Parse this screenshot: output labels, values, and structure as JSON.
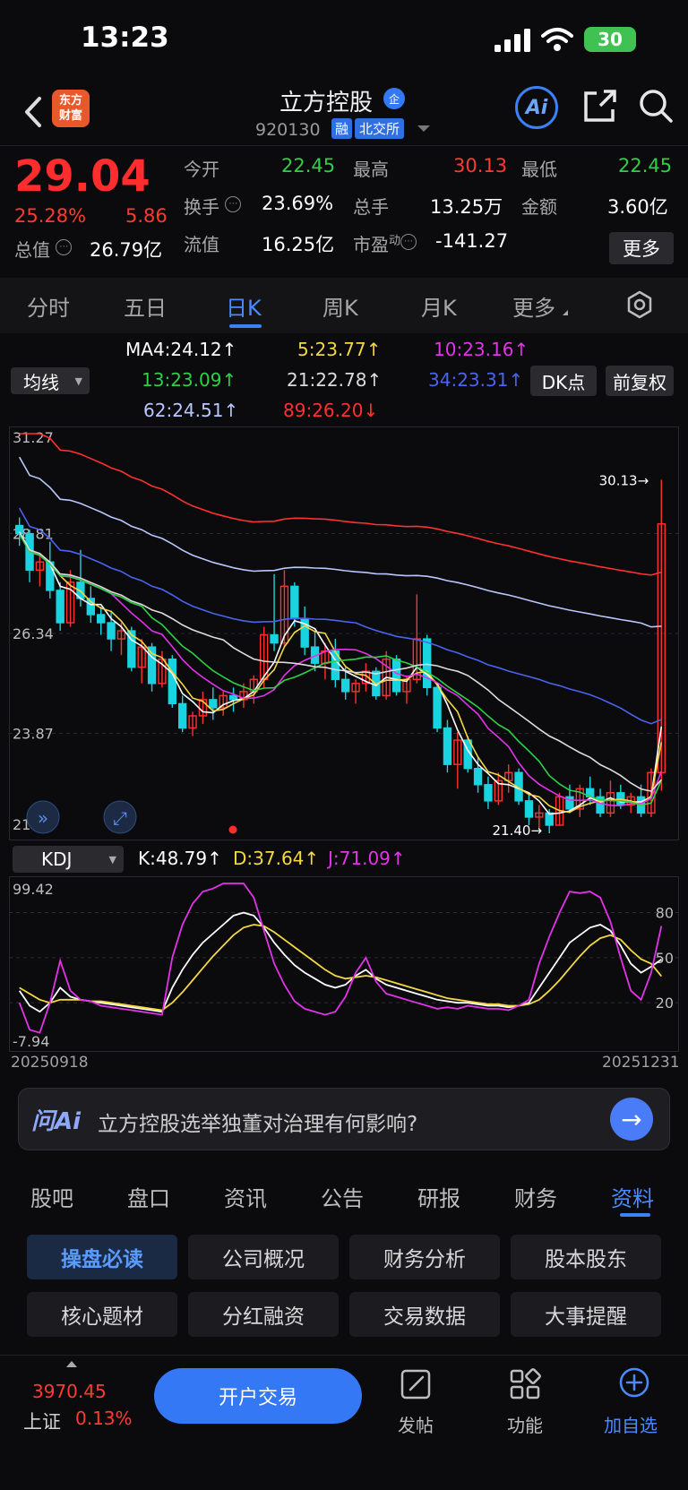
{
  "status": {
    "time": "13:23",
    "battery": "30"
  },
  "header": {
    "logo_line1": "东方",
    "logo_line2": "财富",
    "stock_name": "立方控股",
    "enterprise_badge": "企",
    "stock_code": "920130",
    "tag_margin": "融",
    "tag_exchange": "北交所",
    "ai_label": "Ai"
  },
  "quote": {
    "price": "29.04",
    "change_pct": "25.28%",
    "change_abs": "5.86",
    "open_label": "今开",
    "open": "22.45",
    "high_label": "最高",
    "high": "30.13",
    "low_label": "最低",
    "low": "22.45",
    "turnover_label": "换手",
    "turnover": "23.69%",
    "volume_label": "总手",
    "volume": "13.25万",
    "amount_label": "金额",
    "amount": "3.60亿",
    "mktcap_label": "总值",
    "mktcap": "26.79亿",
    "float_label": "流值",
    "float_cap": "16.25亿",
    "pe_label": "市盈",
    "pe_sup": "动",
    "pe": "-141.27",
    "more_label": "更多"
  },
  "period_tabs": [
    "分时",
    "五日",
    "日K",
    "周K",
    "月K",
    "更多"
  ],
  "ma": {
    "selector": "均线",
    "dk_label": "DK点",
    "adjust_label": "前复权",
    "items": [
      {
        "text": "MA4:24.12↑",
        "color": "#ffffff"
      },
      {
        "text": "5:23.77↑",
        "color": "#f5d742"
      },
      {
        "text": "10:23.16↑",
        "color": "#e233e8"
      },
      {
        "text": "13:23.09↑",
        "color": "#2ed047"
      },
      {
        "text": "21:22.78↑",
        "color": "#dcdcdc"
      },
      {
        "text": "34:23.31↑",
        "color": "#4a63f0"
      },
      {
        "text": "62:24.51↑",
        "color": "#b9c7ff"
      },
      {
        "text": "89:26.20↓",
        "color": "#ff3030"
      }
    ]
  },
  "chart_data": [
    {
      "type": "candlestick",
      "y_ticks": [
        "31.27",
        "28.81",
        "26.34",
        "23.87",
        "21.40"
      ],
      "ylim": [
        21.4,
        31.27
      ],
      "high_marker": "30.13→",
      "low_marker": "21.40→",
      "ohlc": [
        [
          29.0,
          29.2,
          28.5,
          28.8
        ],
        [
          28.8,
          28.9,
          27.6,
          27.9
        ],
        [
          27.9,
          28.3,
          27.5,
          28.1
        ],
        [
          28.1,
          28.6,
          27.2,
          27.4
        ],
        [
          27.4,
          27.6,
          26.4,
          26.6
        ],
        [
          26.6,
          27.9,
          26.5,
          27.6
        ],
        [
          27.6,
          28.4,
          27.0,
          27.2
        ],
        [
          27.2,
          27.5,
          26.6,
          26.8
        ],
        [
          26.8,
          27.0,
          26.3,
          26.6
        ],
        [
          26.6,
          26.9,
          25.9,
          26.2
        ],
        [
          26.2,
          26.6,
          25.8,
          26.4
        ],
        [
          26.4,
          26.5,
          25.4,
          25.5
        ],
        [
          25.5,
          26.2,
          25.1,
          26.0
        ],
        [
          26.0,
          26.1,
          24.9,
          25.1
        ],
        [
          25.1,
          25.9,
          25.0,
          25.7
        ],
        [
          25.7,
          25.8,
          24.5,
          24.6
        ],
        [
          24.6,
          24.8,
          23.9,
          24.0
        ],
        [
          24.0,
          24.4,
          23.8,
          24.3
        ],
        [
          24.3,
          24.9,
          24.1,
          24.7
        ],
        [
          24.7,
          25.0,
          24.2,
          24.5
        ],
        [
          24.5,
          24.9,
          24.3,
          24.8
        ],
        [
          24.8,
          25.0,
          24.4,
          24.7
        ],
        [
          24.7,
          25.1,
          24.5,
          24.9
        ],
        [
          24.9,
          25.3,
          24.6,
          25.2
        ],
        [
          25.2,
          26.5,
          25.0,
          26.3
        ],
        [
          26.3,
          27.8,
          25.9,
          26.1
        ],
        [
          26.1,
          27.9,
          26.0,
          27.5
        ],
        [
          27.5,
          27.6,
          26.5,
          26.7
        ],
        [
          26.7,
          27.0,
          25.8,
          26.0
        ],
        [
          26.0,
          26.4,
          25.4,
          25.6
        ],
        [
          25.6,
          26.1,
          25.2,
          25.9
        ],
        [
          25.9,
          26.2,
          25.0,
          25.2
        ],
        [
          25.2,
          25.5,
          24.7,
          24.9
        ],
        [
          24.9,
          25.2,
          24.6,
          25.1
        ],
        [
          25.1,
          25.6,
          24.9,
          25.4
        ],
        [
          25.4,
          25.5,
          24.7,
          24.8
        ],
        [
          24.8,
          25.9,
          24.7,
          25.7
        ],
        [
          25.7,
          25.8,
          24.8,
          24.9
        ],
        [
          24.9,
          25.3,
          24.6,
          25.2
        ],
        [
          25.2,
          27.3,
          25.1,
          26.2
        ],
        [
          26.2,
          26.3,
          24.8,
          25.0
        ],
        [
          25.0,
          25.1,
          23.9,
          24.0
        ],
        [
          24.0,
          24.2,
          22.9,
          23.1
        ],
        [
          23.1,
          23.9,
          22.5,
          23.7
        ],
        [
          23.7,
          23.8,
          22.9,
          23.0
        ],
        [
          23.0,
          23.3,
          22.4,
          22.6
        ],
        [
          22.6,
          22.8,
          22.0,
          22.2
        ],
        [
          22.2,
          22.9,
          22.1,
          22.7
        ],
        [
          22.7,
          23.1,
          22.4,
          22.9
        ],
        [
          22.9,
          23.0,
          22.1,
          22.2
        ],
        [
          22.2,
          22.4,
          21.6,
          21.8
        ],
        [
          21.8,
          22.1,
          21.5,
          21.9
        ],
        [
          21.9,
          22.0,
          21.4,
          21.6
        ],
        [
          21.6,
          22.4,
          21.6,
          22.3
        ],
        [
          22.3,
          22.6,
          21.9,
          22.0
        ],
        [
          22.0,
          22.6,
          21.8,
          22.5
        ],
        [
          22.5,
          22.8,
          22.1,
          22.3
        ],
        [
          22.3,
          22.5,
          21.8,
          21.9
        ],
        [
          21.9,
          22.7,
          21.8,
          22.4
        ],
        [
          22.4,
          22.6,
          22.0,
          22.1
        ],
        [
          22.1,
          22.4,
          21.9,
          22.3
        ],
        [
          22.3,
          22.6,
          21.8,
          21.9
        ],
        [
          21.9,
          23.0,
          21.8,
          22.9
        ],
        [
          22.9,
          30.13,
          22.45,
          29.04
        ]
      ]
    },
    {
      "type": "line",
      "indicator": "KDJ",
      "y_ticks": [
        "99.42",
        "80",
        "50",
        "20",
        "-7.94"
      ],
      "ylim": [
        -7.94,
        99.42
      ],
      "x_start": "20250918",
      "x_end": "20251231",
      "series": [
        {
          "name": "K:48.79↑",
          "color": "#ffffff",
          "values": [
            28,
            18,
            14,
            20,
            30,
            24,
            22,
            21,
            20,
            19,
            18,
            17,
            16,
            15,
            14,
            30,
            42,
            52,
            60,
            66,
            72,
            78,
            80,
            78,
            70,
            60,
            52,
            45,
            40,
            36,
            32,
            30,
            32,
            38,
            42,
            36,
            32,
            30,
            28,
            26,
            24,
            22,
            21,
            20,
            20,
            19,
            18,
            18,
            17,
            18,
            20,
            30,
            40,
            50,
            60,
            65,
            70,
            72,
            68,
            58,
            46,
            40,
            44,
            48.79
          ]
        },
        {
          "name": "D:37.64↑",
          "color": "#f5d742",
          "values": [
            30,
            26,
            22,
            20,
            22,
            22,
            22,
            21,
            21,
            20,
            19,
            18,
            17,
            16,
            15,
            20,
            27,
            35,
            43,
            51,
            58,
            65,
            70,
            72,
            71,
            67,
            62,
            57,
            52,
            47,
            42,
            38,
            36,
            37,
            38,
            37,
            35,
            33,
            31,
            29,
            27,
            25,
            23,
            22,
            21,
            20,
            19,
            19,
            18,
            18,
            19,
            22,
            28,
            35,
            43,
            51,
            58,
            63,
            65,
            62,
            55,
            49,
            46,
            37.64
          ]
        },
        {
          "name": "J:71.09↑",
          "color": "#e233e8",
          "values": [
            20,
            2,
            0,
            20,
            48,
            28,
            22,
            21,
            18,
            17,
            16,
            15,
            14,
            13,
            12,
            50,
            72,
            86,
            94,
            96,
            100,
            104,
            100,
            90,
            68,
            46,
            32,
            21,
            16,
            14,
            12,
            14,
            24,
            40,
            50,
            34,
            26,
            24,
            22,
            20,
            18,
            16,
            17,
            16,
            18,
            17,
            16,
            16,
            15,
            18,
            22,
            46,
            64,
            80,
            94,
            93,
            94,
            90,
            74,
            50,
            28,
            22,
            40,
            71.09
          ]
        }
      ]
    }
  ],
  "kdj_selector": "KDJ",
  "ai_ask": {
    "logo": "问Ai",
    "question": "立方控股选举独董对治理有何影响?"
  },
  "info_tabs": [
    "股吧",
    "盘口",
    "资讯",
    "公告",
    "研报",
    "财务",
    "资料"
  ],
  "info_grid": [
    "操盘必读",
    "公司概况",
    "财务分析",
    "股本股东",
    "核心题材",
    "分红融资",
    "交易数据",
    "大事提醒"
  ],
  "bottom": {
    "index_value": "3970.45",
    "index_name": "上证",
    "index_pct": "0.13%",
    "trade_label": "开户交易",
    "post_label": "发帖",
    "func_label": "功能",
    "watch_label": "加自选"
  },
  "colors": {
    "up": "#ff3030",
    "down": "#19d3e0",
    "accent": "#3478f6"
  }
}
